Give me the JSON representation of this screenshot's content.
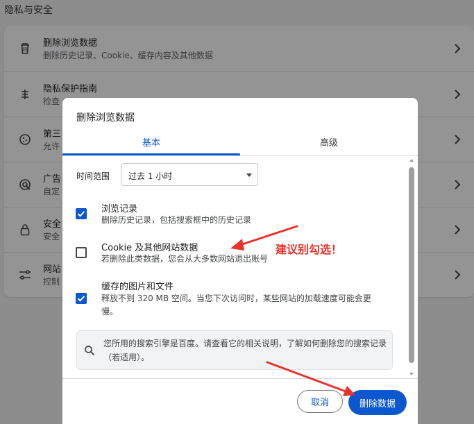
{
  "page": {
    "section_title": "隐私与安全",
    "rows": [
      {
        "title": "删除浏览数据",
        "desc": "删除历史记录、Cookie、缓存内容及其他数据",
        "icon": "trash-icon"
      },
      {
        "title": "隐私保护指南",
        "desc": "检查",
        "icon": "privacy-guide-icon"
      },
      {
        "title": "第三",
        "desc": "允许",
        "icon": "cookie-icon"
      },
      {
        "title": "广告",
        "desc": "自定",
        "icon": "ad-privacy-icon"
      },
      {
        "title": "安全",
        "desc": "安全",
        "icon": "lock-icon"
      },
      {
        "title": "网站",
        "desc": "控制",
        "icon": "site-settings-icon"
      }
    ]
  },
  "dialog": {
    "title": "删除浏览数据",
    "tabs": [
      {
        "label": "基本",
        "active": true
      },
      {
        "label": "高级",
        "active": false
      }
    ],
    "time_range": {
      "label": "时间范围",
      "value": "过去 1 小时"
    },
    "options": [
      {
        "title": "浏览记录",
        "desc": "删除历史记录，包括搜索框中的历史记录",
        "checked": true
      },
      {
        "title": "Cookie 及其他网站数据",
        "desc": "若删除此类数据，您会从大多数网站退出账号",
        "checked": false
      },
      {
        "title": "缓存的图片和文件",
        "desc": "释放不到 320 MB 空间。当您下次访问时，某些网站的加载速度可能会更慢。",
        "checked": true
      }
    ],
    "info": "您所用的搜索引擎是百度。请查看它的相关说明，了解如何删除您的搜索记录（若适用）。",
    "buttons": {
      "cancel": "取消",
      "delete": "删除数据"
    }
  },
  "annotation": {
    "text": "建议别勾选！",
    "color": "#e8332c"
  },
  "colors": {
    "accent": "#0b57d0",
    "annotation": "#e8332c"
  }
}
